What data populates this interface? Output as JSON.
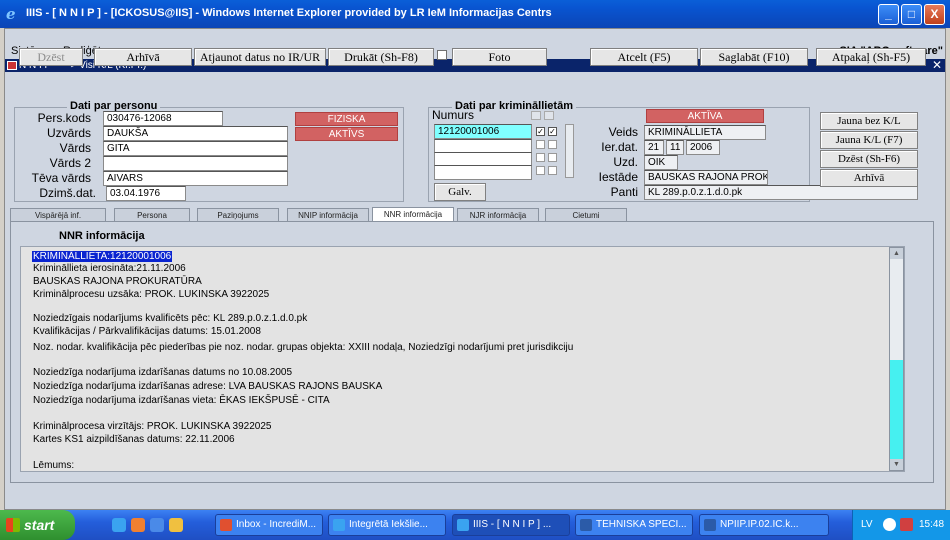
{
  "window": {
    "title": "IIIS - [ N N I P ] - [ICKOSUS@IIS] - Windows Internet Explorer provided by LR IeM Informacijas Centrs",
    "min": "_",
    "max": "□",
    "close": "X"
  },
  "menu": {
    "items": [
      "Sistēmas",
      "Rediģēt"
    ],
    "company": "SIA \"ABC software\""
  },
  "form_title": "N N I P -----> Visi K/L (Kr.Pr.)",
  "toolbar": {
    "dzest": "Dzēst",
    "arhiva": "Arhīvā",
    "atjaunot": "Atjaunot datus no IR/UR",
    "drukat": "Drukāt (Sh-F8)",
    "foto": "Foto",
    "atcelt": "Atcelt (F5)",
    "saglabat": "Saglabāt (F10)",
    "atpakal": "Atpakaļ (Sh-F5)"
  },
  "person": {
    "title": "Dati par personu",
    "labels": {
      "pers_kods": "Pers.kods",
      "uzvards": "Uzvārds",
      "vards": "Vārds",
      "vards2": "Vārds 2",
      "teva_vards": "Tēva vārds",
      "dzims_dat": "Dzimš.dat."
    },
    "values": {
      "pers_kods": "030476-12068",
      "uzvards": "DAUKŠA",
      "vards": "GITA",
      "vards2": "",
      "teva_vards": "AIVARS",
      "dzims_dat": "03.04.1976"
    },
    "badges": {
      "fiziska": "FIZISKA",
      "aktivs": "AKTĪVS"
    }
  },
  "case": {
    "title": "Dati par krimināllietām",
    "numurs_label": "Numurs",
    "numurs": "12120001006",
    "galv": "Galv.",
    "badge": "AKTĪVA",
    "labels": {
      "veids": "Veids",
      "ier_dat": "Ier.dat.",
      "uzd": "Uzd.",
      "iestade": "Iestāde",
      "panti": "Panti"
    },
    "values": {
      "veids": "KRIMINĀLLIETA",
      "ier_day": "21",
      "ier_month": "11",
      "ier_year": "2006",
      "uzd": "OIK",
      "iestade": "BAUSKAS RAJONA PROKURĀ",
      "panti": "KL 289.p.0.z.1.d.0.pk"
    }
  },
  "side_buttons": [
    "Jauna bez K/L",
    "Jauna K/L (F7)",
    "Dzēst (Sh-F6)",
    "Arhīvā"
  ],
  "tabs": [
    "Vispārējā inf.",
    "Persona",
    "Paziņojums",
    "NNIP informācija",
    "NNR informācija",
    "NJR informācija",
    "Cietumi"
  ],
  "active_tab": "NNR informācija",
  "nnr": {
    "title": "NNR informācija",
    "lines": [
      "KRIMINĀLLIETA:12120001006",
      "Krimināllieta ierosināta:21.11.2006",
      "BAUSKAS RAJONA PROKURATŪRA",
      "Kriminālprocesu uzsāka: PROK. LUKINSKA 3922025",
      "",
      "Noziedzīgais nodarījums kvalificēts pēc: KL 289.p.0.z.1.d.0.pk",
      "Kvalifikācijas / Pārkvalifikācijas datums: 15.01.2008",
      "Noz. nodar. kvalifikācija pēc piederības pie noz. nodar. grupas objekta: XXIII nodaļa, Noziedzīgi nodarījumi pret jurisdikciju",
      "",
      "Noziedzīga nodarījuma izdarīšanas datums no 10.08.2005",
      "Noziedzīga nodarījuma izdarīšanas adrese: LVA BAUSKAS RAJONS BAUSKA",
      "Noziedzīga nodarījuma izdarīšanas vieta: ĒKAS IEKŠPUSĒ - CITA",
      "",
      "Kriminālprocesa virzītājs: PROK. LUKINSKA 3922025",
      "Kartes KS1 aizpildīšanas datums: 22.11.2006",
      "",
      "Lēmums:"
    ]
  },
  "taskbar": {
    "start": "start",
    "tasks": [
      "Inbox - IncrediM...",
      "Integrētā Iekšlie...",
      "IIIS - [ N N I P ] ...",
      "TEHNISKA SPECI...",
      "NPIIP.IP.02.IC.k..."
    ],
    "lang": "LV",
    "clock": "15:48"
  }
}
